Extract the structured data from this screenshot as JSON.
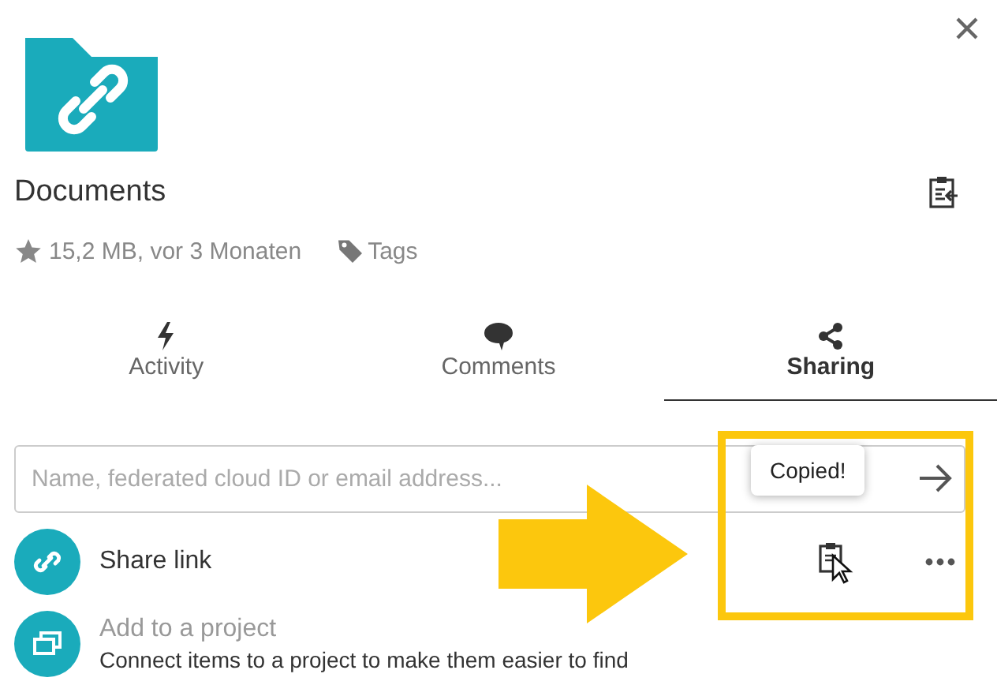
{
  "file": {
    "name": "Documents",
    "meta": "15,2 MB, vor 3 Monaten",
    "tags_label": "Tags"
  },
  "tabs": [
    {
      "label": "Activity",
      "kind": "activity",
      "selected": false
    },
    {
      "label": "Comments",
      "kind": "comments",
      "selected": false
    },
    {
      "label": "Sharing",
      "kind": "sharing",
      "selected": true
    }
  ],
  "share_input": {
    "placeholder": "Name, federated cloud ID or email address..."
  },
  "share_link": {
    "label": "Share link"
  },
  "project": {
    "title": "Add to a project",
    "subtitle": "Connect items to a project to make them easier to find"
  },
  "tooltip": {
    "text": "Copied!"
  }
}
